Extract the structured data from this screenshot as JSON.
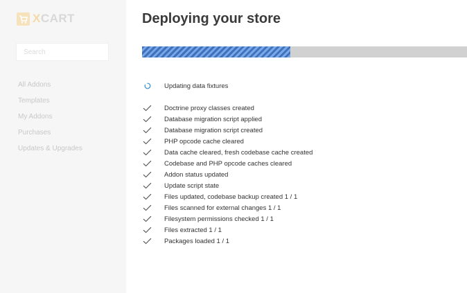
{
  "sidebar": {
    "logo_text": "XCART",
    "search": {
      "placeholder": "Search",
      "value": ""
    },
    "items": [
      {
        "label": "All Addons"
      },
      {
        "label": "Templates"
      },
      {
        "label": "My Addons"
      },
      {
        "label": "Purchases"
      },
      {
        "label": "Updates & Upgrades"
      }
    ]
  },
  "main": {
    "title": "Deploying your store",
    "progress_fraction": 0.456,
    "current_step": {
      "label": "Updating data fixtures",
      "icon": "spinner-icon"
    },
    "completed_steps": [
      {
        "label": "Doctrine proxy classes created"
      },
      {
        "label": "Database migration script applied"
      },
      {
        "label": "Database migration script created"
      },
      {
        "label": "PHP opcode cache cleared"
      },
      {
        "label": "Data cache cleared, fresh codebase cache created"
      },
      {
        "label": "Codebase and PHP opcode caches cleared"
      },
      {
        "label": "Addon status updated"
      },
      {
        "label": "Update script state"
      },
      {
        "label": "Files updated, codebase backup created 1 / 1"
      },
      {
        "label": "Files scanned for external changes 1 / 1"
      },
      {
        "label": "Filesystem permissions checked 1 / 1"
      },
      {
        "label": "Files extracted 1 / 1"
      },
      {
        "label": "Packages loaded 1 / 1"
      }
    ]
  },
  "colors": {
    "progress_fill": "#3f72be",
    "progress_track": "#d1d1d1",
    "spinner": "#2e8ed6",
    "sidebar_bg": "#f6f6f6"
  }
}
